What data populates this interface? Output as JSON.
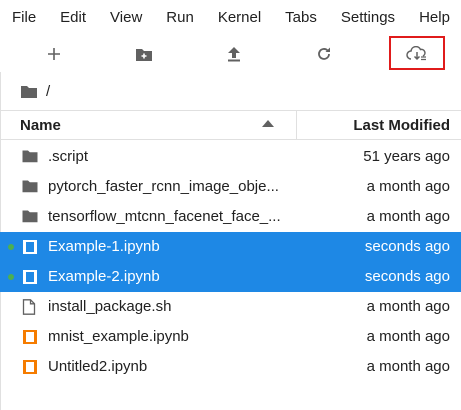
{
  "menu": [
    "File",
    "Edit",
    "View",
    "Run",
    "Kernel",
    "Tabs",
    "Settings",
    "Help"
  ],
  "toolbar": {
    "new_launcher_icon": "plus-icon",
    "new_folder_icon": "new-folder-icon",
    "upload_icon": "upload-icon",
    "refresh_icon": "refresh-icon",
    "git_clone_icon": "cloud-download-icon"
  },
  "breadcrumb": {
    "path": "/"
  },
  "columns": {
    "name": "Name",
    "modified": "Last Modified"
  },
  "files": [
    {
      "name": ".script",
      "type": "folder",
      "modified": "51 years ago",
      "selected": false,
      "running": false
    },
    {
      "name": "pytorch_faster_rcnn_image_obje...",
      "type": "folder",
      "modified": "a month ago",
      "selected": false,
      "running": false
    },
    {
      "name": "tensorflow_mtcnn_facenet_face_...",
      "type": "folder",
      "modified": "a month ago",
      "selected": false,
      "running": false
    },
    {
      "name": "Example-1.ipynb",
      "type": "notebook",
      "modified": "seconds ago",
      "selected": true,
      "running": true
    },
    {
      "name": "Example-2.ipynb",
      "type": "notebook",
      "modified": "seconds ago",
      "selected": true,
      "running": true
    },
    {
      "name": "install_package.sh",
      "type": "file",
      "modified": "a month ago",
      "selected": false,
      "running": false
    },
    {
      "name": "mnist_example.ipynb",
      "type": "notebook",
      "modified": "a month ago",
      "selected": false,
      "running": false
    },
    {
      "name": "Untitled2.ipynb",
      "type": "notebook",
      "modified": "a month ago",
      "selected": false,
      "running": false
    }
  ],
  "colors": {
    "selection": "#1e88e5",
    "running_dot": "#4caf50",
    "notebook_icon": "#f57c00",
    "highlight": "#e01b1b"
  }
}
